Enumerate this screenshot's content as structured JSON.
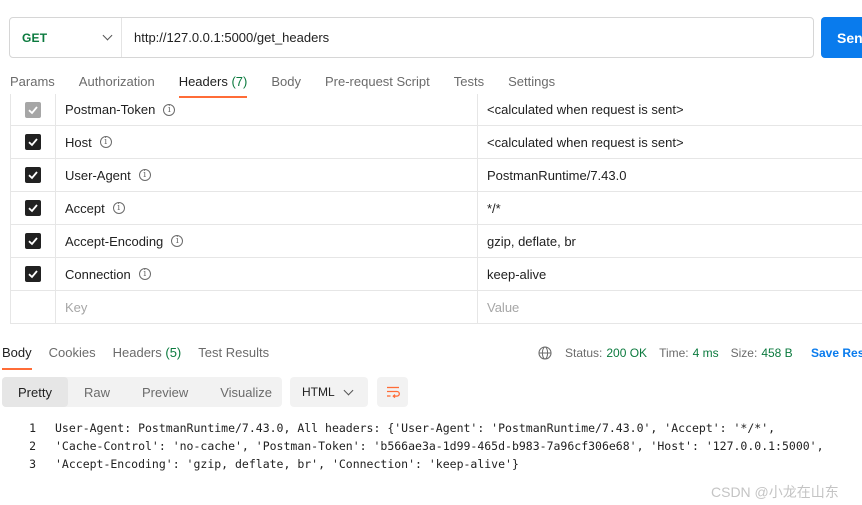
{
  "request": {
    "method": "GET",
    "url": "http://127.0.0.1:5000/get_headers",
    "send_label": "Send"
  },
  "request_tabs": [
    {
      "label": "Params"
    },
    {
      "label": "Authorization"
    },
    {
      "label": "Headers",
      "count": "(7)"
    },
    {
      "label": "Body"
    },
    {
      "label": "Pre-request Script"
    },
    {
      "label": "Tests"
    },
    {
      "label": "Settings"
    }
  ],
  "headers": [
    {
      "key": "Postman-Token",
      "value": "<calculated when request is sent>"
    },
    {
      "key": "Host",
      "value": "<calculated when request is sent>"
    },
    {
      "key": "User-Agent",
      "value": "PostmanRuntime/7.43.0"
    },
    {
      "key": "Accept",
      "value": "*/*"
    },
    {
      "key": "Accept-Encoding",
      "value": "gzip, deflate, br"
    },
    {
      "key": "Connection",
      "value": "keep-alive"
    }
  ],
  "new_header": {
    "key_placeholder": "Key",
    "value_placeholder": "Value"
  },
  "response_tabs": [
    {
      "label": "Body"
    },
    {
      "label": "Cookies"
    },
    {
      "label": "Headers",
      "count": "(5)"
    },
    {
      "label": "Test Results"
    }
  ],
  "status": {
    "status_label": "Status:",
    "status_value": "200 OK",
    "time_label": "Time:",
    "time_value": "4 ms",
    "size_label": "Size:",
    "size_value": "458 B",
    "save_label": "Save Res"
  },
  "view_modes": [
    "Pretty",
    "Raw",
    "Preview",
    "Visualize"
  ],
  "format": "HTML",
  "code_lines": [
    {
      "num": "1",
      "text": "User-Agent: PostmanRuntime/7.43.0, All headers: {'User-Agent': 'PostmanRuntime/7.43.0', 'Accept': '*/*',"
    },
    {
      "num": "2",
      "text": "'Cache-Control': 'no-cache', 'Postman-Token': 'b566ae3a-1d99-465d-b983-7a96cf306e68', 'Host': '127.0.0.1:5000',"
    },
    {
      "num": "3",
      "text": "'Accept-Encoding': 'gzip, deflate, br', 'Connection': 'keep-alive'}"
    }
  ],
  "watermark": "CSDN @小龙在山东",
  "colors": {
    "accent": "#ff6c37",
    "send": "#097bed",
    "success": "#0b7a3e"
  }
}
